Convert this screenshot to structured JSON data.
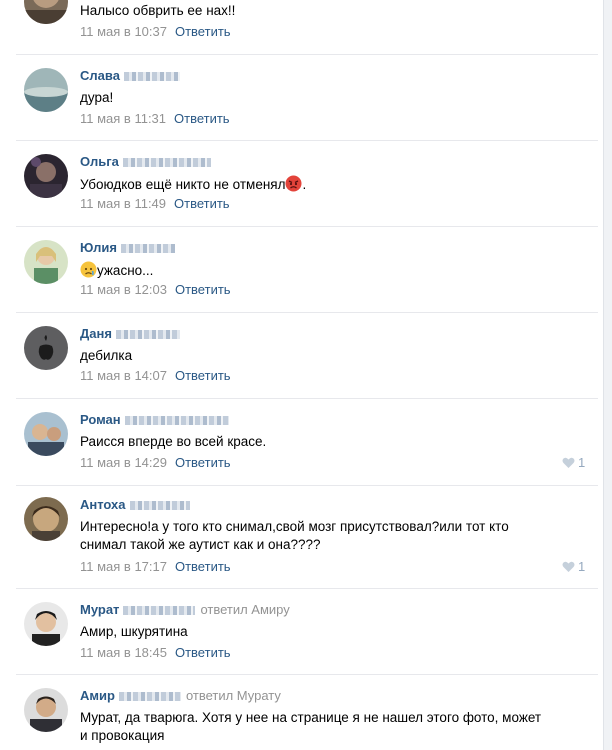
{
  "comments": [
    {
      "author": "",
      "text": "Налысо обврить ее нах!!",
      "date": "11 мая в 10:37",
      "reply_label": "Ответить"
    },
    {
      "author": "Слава",
      "text": "дура!",
      "date": "11 мая в 11:31",
      "reply_label": "Ответить"
    },
    {
      "author": "Ольга",
      "text": "Убоюдков ещё никто не отменял",
      "text_suffix": ".",
      "emoji": "angry-face-icon",
      "date": "11 мая в 11:49",
      "reply_label": "Ответить"
    },
    {
      "author": "Юлия",
      "text": "ужасно...",
      "emoji": "sad-face-icon",
      "date": "11 мая в 12:03",
      "reply_label": "Ответить"
    },
    {
      "author": "Даня",
      "text": "дебилка",
      "date": "11 мая в 14:07",
      "reply_label": "Ответить"
    },
    {
      "author": "Роман",
      "text": "Раисся вперде во всей красе.",
      "date": "11 мая в 14:29",
      "reply_label": "Ответить",
      "likes": "1"
    },
    {
      "author": "Антоха",
      "text_line1": "Интересно!а у того кто снимал,свой мозг присутствовал?или тот кто",
      "text_line2": "снимал такой же аутист как и она????",
      "date": "11 мая в 17:17",
      "reply_label": "Ответить",
      "likes": "1"
    },
    {
      "author": "Мурат",
      "replied_to": "ответил Амиру",
      "text": "Амир, шкурятина",
      "date": "11 мая в 18:45",
      "reply_label": "Ответить"
    },
    {
      "author": "Амир",
      "replied_to": "ответил Мурату",
      "text_line1": "Мурат, да тварюга. Хотя у нее на странице я не нашел этого фото, может",
      "text_line2": "и провокация"
    }
  ],
  "colors": {
    "link": "#2a5885",
    "meta": "#939393",
    "like": "#95a9bf",
    "separator": "#e7e8ec"
  }
}
